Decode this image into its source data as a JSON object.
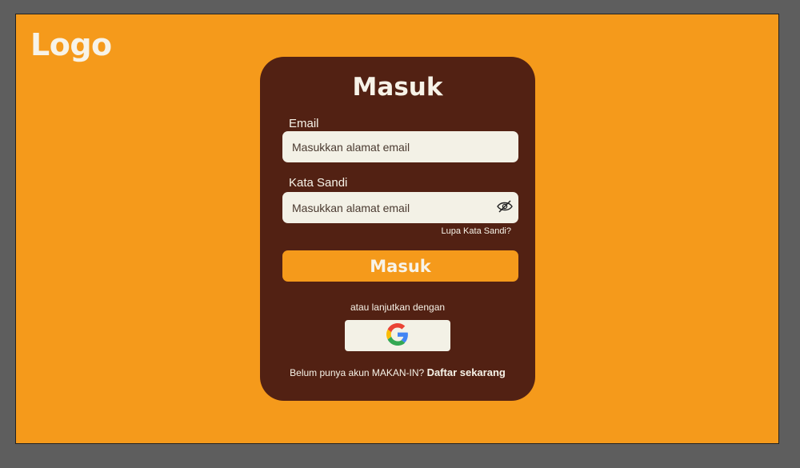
{
  "brand": {
    "logo_text": "Logo"
  },
  "login": {
    "title": "Masuk",
    "email_label": "Email",
    "email_placeholder": "Masukkan alamat email",
    "password_label": "Kata Sandi",
    "password_placeholder": "Masukkan alamat email",
    "forgot_link": "Lupa Kata Sandi?",
    "submit_label": "Masuk",
    "alt_text": "atau lanjutkan dengan",
    "signup_prefix": "Belum punya akun MAKAN-IN?",
    "signup_link": "Daftar sekarang"
  },
  "icons": {
    "password_toggle": "eye-off-icon",
    "google": "google-icon"
  },
  "colors": {
    "background": "#f59a1b",
    "card": "#522113",
    "field": "#f3f1e6",
    "text_light": "#f7f3e8"
  }
}
